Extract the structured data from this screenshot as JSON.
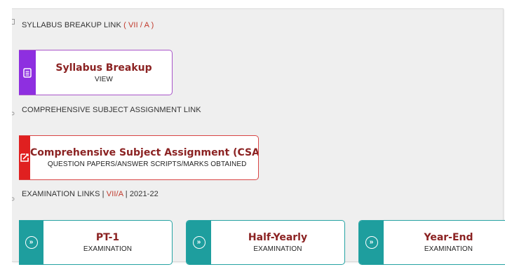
{
  "sections": {
    "syllabus": {
      "heading": "SYLLABUS BREAKUP LINK",
      "heading_class": "( VII / A )",
      "card": {
        "title": "Syllabus Breakup",
        "subtitle": "VIEW",
        "icon": "document-icon",
        "color": "#8e2fe0"
      }
    },
    "csa": {
      "heading": "COMPREHENSIVE SUBJECT ASSIGNMENT LINK",
      "card": {
        "title": "Comprehensive Subject Assignment (CSA)",
        "subtitle": "QUESTION PAPERS/ANSWER SCRIPTS/MARKS OBTAINED",
        "icon": "edit-icon",
        "color": "#e02020"
      }
    },
    "exams": {
      "heading_prefix": "EXAMINATION LINKS |",
      "heading_class": "VII/A",
      "heading_year": "| 2021-22",
      "color": "#1e9e9e",
      "cards": [
        {
          "title": "PT-1",
          "subtitle": "EXAMINATION",
          "icon": "double-chevron-right-icon"
        },
        {
          "title": "Half-Yearly",
          "subtitle": "EXAMINATION",
          "icon": "double-chevron-right-icon"
        },
        {
          "title": "Year-End",
          "subtitle": "EXAMINATION",
          "icon": "double-chevron-right-icon"
        }
      ]
    }
  }
}
